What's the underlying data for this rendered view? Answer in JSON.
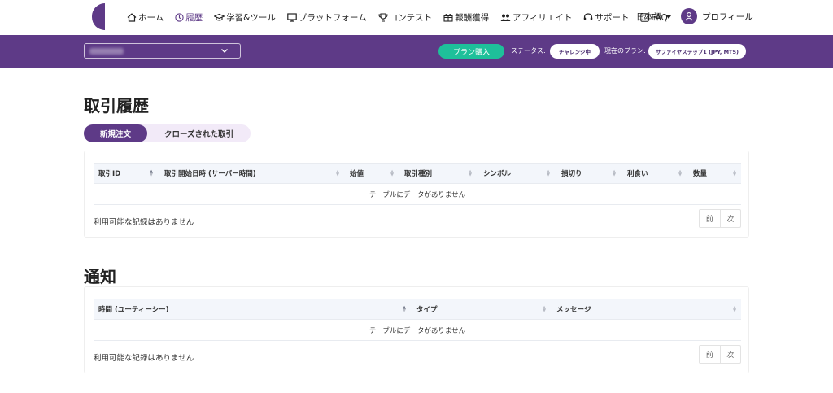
{
  "nav": {
    "items": [
      {
        "label": "ホーム",
        "icon": "home-icon"
      },
      {
        "label": "履歴",
        "icon": "clock-icon",
        "active": true
      },
      {
        "label": "学習&ツール",
        "icon": "graduation-cap-icon"
      },
      {
        "label": "プラットフォーム",
        "icon": "monitor-icon"
      },
      {
        "label": "コンテスト",
        "icon": "trophy-icon"
      },
      {
        "label": "報酬獲得",
        "icon": "gift-icon"
      },
      {
        "label": "アフィリエイト",
        "icon": "users-icon"
      },
      {
        "label": "サポート",
        "icon": "headset-icon"
      },
      {
        "label": "FAQ",
        "icon": "question-icon"
      }
    ],
    "language": "日本語",
    "profile": "プロフィール"
  },
  "bar": {
    "plan_button": "プラン購入",
    "status_label": "ステータス:",
    "status_value": "チャレンジ中",
    "plan_label": "現在のプラン:",
    "plan_value": "サファイヤステップ1 (JPY, MT5)"
  },
  "history": {
    "title": "取引履歴",
    "tabs": [
      "新規注文",
      "クローズされた取引"
    ],
    "columns": [
      "取引ID",
      "取引開始日時 (サーバー時間)",
      "始値",
      "取引種別",
      "シンボル",
      "損切り",
      "利食い",
      "数量"
    ],
    "empty": "テーブルにデータがありません",
    "info": "利用可能な記録はありません",
    "prev": "前",
    "next": "次"
  },
  "notifications": {
    "title": "通知",
    "columns": [
      "時間 (ユーティーシー)",
      "タイプ",
      "メッセージ"
    ],
    "empty": "テーブルにデータがありません",
    "info": "利用可能な記録はありません",
    "prev": "前",
    "next": "次"
  },
  "colors": {
    "brand": "#5e3a87",
    "accent": "#1ec09a"
  }
}
